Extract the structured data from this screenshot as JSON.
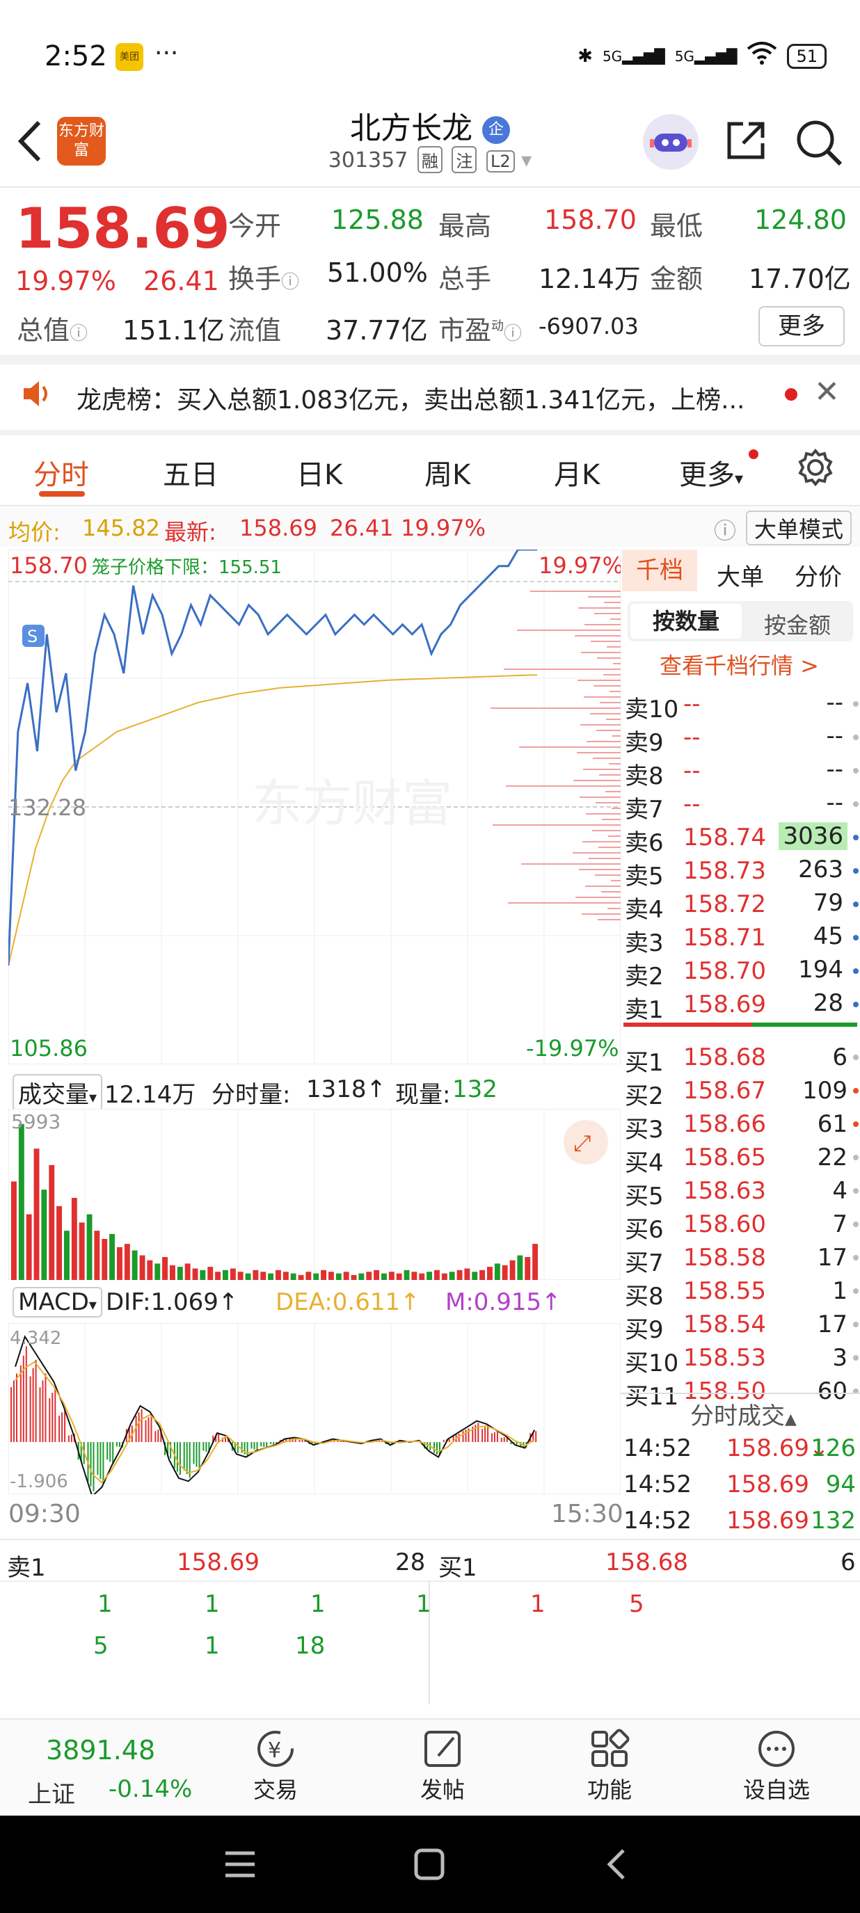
{
  "status_bar": {
    "time": "2:52",
    "app_badge": "美团",
    "more": "···",
    "battery": "51"
  },
  "header": {
    "logo": "东方财富",
    "name": "北方长龙",
    "badge": "企",
    "code": "301357",
    "tags": [
      "融",
      "注",
      "L2"
    ]
  },
  "quote": {
    "price": "158.69",
    "change_pct": "19.97%",
    "change": "26.41",
    "fields": [
      {
        "k": "今开",
        "v": "125.88",
        "c": "green"
      },
      {
        "k": "最高",
        "v": "158.70",
        "c": "red"
      },
      {
        "k": "最低",
        "v": "124.80",
        "c": "green"
      },
      {
        "k": "换手",
        "v": "51.00%",
        "c": "dark"
      },
      {
        "k": "总手",
        "v": "12.14万",
        "c": "dark"
      },
      {
        "k": "金额",
        "v": "17.70亿",
        "c": "dark"
      },
      {
        "k": "总值",
        "v": "151.1亿",
        "c": "dark"
      },
      {
        "k": "流值",
        "v": "37.77亿",
        "c": "dark"
      },
      {
        "k": "市盈",
        "v": "-6907.03",
        "c": "dark"
      }
    ],
    "pe_mark": "动",
    "more_label": "更多"
  },
  "notice": {
    "text": "龙虎榜：买入总额1.083亿元，卖出总额1.341亿元，上榜..."
  },
  "tabs": [
    "分时",
    "五日",
    "日K",
    "周K",
    "月K",
    "更多"
  ],
  "indicator": {
    "avg_label": "均价:",
    "avg": "145.82",
    "latest_label": "最新:",
    "latest": "158.69",
    "chg": "26.41",
    "pct": "19.97%",
    "mode": "大单模式"
  },
  "intraday": {
    "y_top": "158.70",
    "y_mid": "132.28",
    "y_bottom": "105.86",
    "pct_top": "19.97%",
    "pct_bottom": "-19.97%",
    "cage_label": "笼子价格下限：155.51",
    "watermark": "东方财富",
    "s_marker": "S",
    "price": [
      116,
      140,
      145,
      138,
      150,
      142,
      146,
      136,
      140,
      148,
      152,
      150,
      146,
      155,
      150,
      154,
      152,
      148,
      150,
      153,
      151,
      154,
      153,
      152,
      151,
      153,
      152,
      150,
      151,
      152,
      151,
      150,
      151,
      152,
      150,
      151,
      152,
      151,
      152,
      151,
      150,
      151,
      150,
      151,
      148,
      150,
      151,
      153,
      154,
      155,
      156,
      157,
      157,
      158.7,
      158.7,
      158.7
    ],
    "avg": [
      116,
      122,
      128,
      132,
      135,
      137,
      138,
      139,
      140,
      140.5,
      141,
      141.5,
      142,
      142.5,
      143,
      143.3,
      143.6,
      143.9,
      144.1,
      144.3,
      144.5,
      144.6,
      144.7,
      144.8,
      144.9,
      145,
      145.1,
      145.2,
      145.3,
      145.35,
      145.4,
      145.45,
      145.5,
      145.55,
      145.6,
      145.65,
      145.7,
      145.75,
      145.8,
      145.82
    ]
  },
  "volume": {
    "label": "成交量",
    "total": "12.14万",
    "period_label": "分时量:",
    "period": "1318",
    "current_label": "现量:",
    "current": "132",
    "max": "5993",
    "bars": [
      60,
      95,
      40,
      80,
      55,
      70,
      45,
      30,
      50,
      35,
      40,
      30,
      25,
      28,
      20,
      22,
      18,
      15,
      12,
      10,
      14,
      9,
      8,
      10,
      7,
      6,
      8,
      5,
      6,
      7,
      5,
      4,
      6,
      5,
      4,
      6,
      5,
      4,
      3,
      5,
      4,
      6,
      5,
      4,
      5,
      3,
      4,
      5,
      6,
      4,
      5,
      4,
      6,
      5,
      4,
      5,
      6,
      4,
      5,
      6,
      7,
      5,
      6,
      8,
      10,
      9,
      12,
      15,
      14,
      22
    ]
  },
  "macd": {
    "label": "MACD",
    "dif": "DIF:1.069",
    "dea": "DEA:0.611",
    "m": "M:0.915",
    "max": "4.342",
    "min": "-1.906",
    "hist": [
      2.5,
      3.5,
      3,
      2.5,
      2,
      1.2,
      0.3,
      -0.8,
      -1.8,
      -1.5,
      -0.8,
      -0.2,
      0.6,
      1.2,
      1,
      0.5,
      -0.6,
      -1.2,
      -1.3,
      -1,
      -0.4,
      0.3,
      0.2,
      -0.4,
      -0.5,
      -0.3,
      -0.2,
      -0.1,
      0.1,
      0.15,
      0.1,
      -0.1,
      0,
      0.1,
      0.05,
      0,
      -0.05,
      0.05,
      0.1,
      -0.1,
      0.05,
      0,
      0.05,
      -0.3,
      -0.5,
      0.1,
      0.3,
      0.5,
      0.7,
      0.6,
      0.4,
      0.2,
      -0.1,
      -0.2,
      0.4
    ]
  },
  "time_axis": {
    "start": "09:30",
    "end": "15:30"
  },
  "book": {
    "tabs": [
      "千档",
      "大单",
      "分价"
    ],
    "sub": [
      "按数量",
      "按金额"
    ],
    "link": "查看千档行情 >",
    "asks": [
      {
        "l": "卖10",
        "p": "--",
        "v": "--"
      },
      {
        "l": "卖9",
        "p": "--",
        "v": "--"
      },
      {
        "l": "卖8",
        "p": "--",
        "v": "--"
      },
      {
        "l": "卖7",
        "p": "--",
        "v": "--"
      },
      {
        "l": "卖6",
        "p": "158.74",
        "v": "3036"
      },
      {
        "l": "卖5",
        "p": "158.73",
        "v": "263"
      },
      {
        "l": "卖4",
        "p": "158.72",
        "v": "79"
      },
      {
        "l": "卖3",
        "p": "158.71",
        "v": "45"
      },
      {
        "l": "卖2",
        "p": "158.70",
        "v": "194"
      },
      {
        "l": "卖1",
        "p": "158.69",
        "v": "28"
      }
    ],
    "bids": [
      {
        "l": "买1",
        "p": "158.68",
        "v": "6"
      },
      {
        "l": "买2",
        "p": "158.67",
        "v": "109"
      },
      {
        "l": "买3",
        "p": "158.66",
        "v": "61"
      },
      {
        "l": "买4",
        "p": "158.65",
        "v": "22"
      },
      {
        "l": "买5",
        "p": "158.63",
        "v": "4"
      },
      {
        "l": "买6",
        "p": "158.60",
        "v": "7"
      },
      {
        "l": "买7",
        "p": "158.58",
        "v": "17"
      },
      {
        "l": "买8",
        "p": "158.55",
        "v": "1"
      },
      {
        "l": "买9",
        "p": "158.54",
        "v": "17"
      },
      {
        "l": "买10",
        "p": "158.53",
        "v": "3"
      },
      {
        "l": "买11",
        "p": "158.50",
        "v": "60"
      }
    ],
    "trades_title": "分时成交",
    "trades": [
      {
        "t": "14:52",
        "p": "158.69↓",
        "v": "126"
      },
      {
        "t": "14:52",
        "p": "158.69",
        "v": "94"
      },
      {
        "t": "14:52",
        "p": "158.69",
        "v": "132"
      }
    ]
  },
  "queue": {
    "sell_label": "卖1",
    "sell_price": "158.69",
    "sell_qty": "28",
    "buy_label": "买1",
    "buy_price": "158.68",
    "buy_qty": "6",
    "sell_orders": [
      "1",
      "1",
      "1",
      "1",
      "5",
      "1",
      "18"
    ],
    "buy_orders": [
      "1",
      "5"
    ]
  },
  "bottom_nav": {
    "index_name": "上证",
    "index_value": "3891.48",
    "index_pct": "-0.14%",
    "items": [
      "交易",
      "发帖",
      "功能",
      "设自选"
    ]
  }
}
